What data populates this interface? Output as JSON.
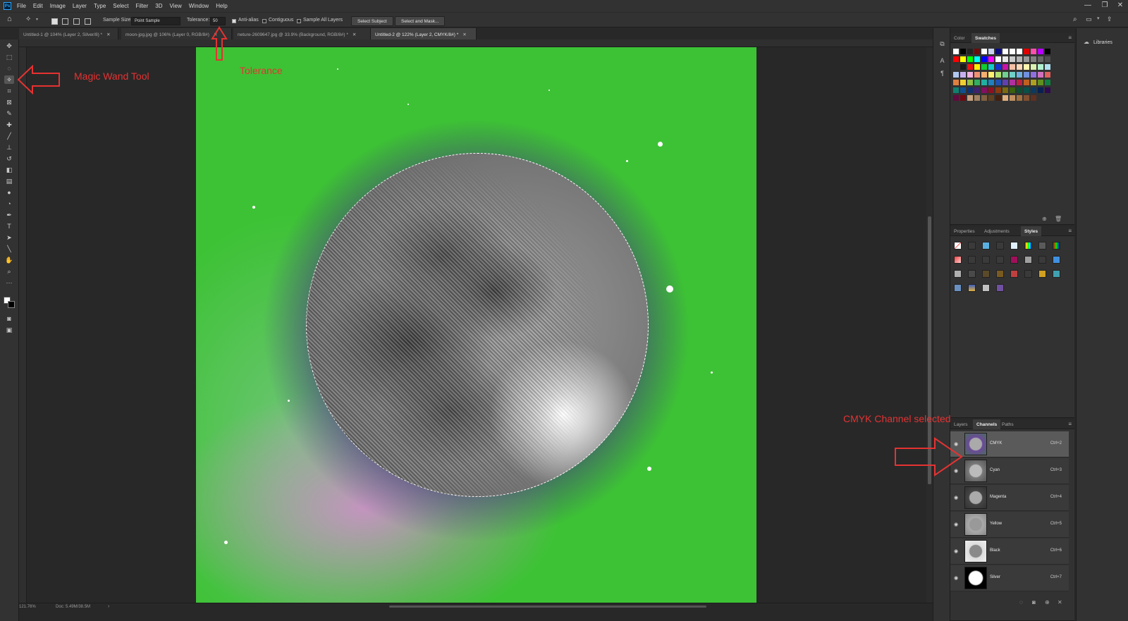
{
  "menu": {
    "items": [
      "File",
      "Edit",
      "Image",
      "Layer",
      "Type",
      "Select",
      "Filter",
      "3D",
      "View",
      "Window",
      "Help"
    ]
  },
  "options": {
    "sample_size_label": "Sample Size:",
    "sample_size_value": "Point Sample",
    "tolerance_label": "Tolerance:",
    "tolerance_value": "50",
    "anti_alias_label": "Anti-alias",
    "anti_alias_checked": true,
    "contiguous_label": "Contiguous",
    "contiguous_checked": false,
    "sample_all_layers_label": "Sample All Layers",
    "sample_all_layers_checked": false,
    "select_subject_label": "Select Subject",
    "select_and_mask_label": "Select and Mask..."
  },
  "tabs": [
    {
      "label": "Untitled-1 @ 104% (Layer 2, Silver/8) *",
      "active": false
    },
    {
      "label": "moon-jpg.jpg @ 106% (Layer 0, RGB/8#)",
      "active": false
    },
    {
      "label": "neture-2609647.jpg @ 33.9% (Background, RGB/8#) *",
      "active": false
    },
    {
      "label": "Untitled-2 @ 122% (Layer 2, CMYK/8#) *",
      "active": true
    }
  ],
  "status": {
    "zoom": "121.76%",
    "doc_info": "Doc: 5.49M/38.5M"
  },
  "color_panel": {
    "tabs": [
      "Color",
      "Swatches"
    ],
    "active_tab": "Swatches"
  },
  "styles_panel": {
    "tabs": [
      "Properties",
      "Adjustments",
      "Styles"
    ],
    "active_tab": "Styles"
  },
  "channels_panel": {
    "tabs": [
      "Layers",
      "Channels",
      "Paths"
    ],
    "active_tab": "Channels",
    "channels": [
      {
        "name": "CMYK",
        "shortcut": "Ctrl+2",
        "selected": true
      },
      {
        "name": "Cyan",
        "shortcut": "Ctrl+3",
        "selected": false
      },
      {
        "name": "Magenta",
        "shortcut": "Ctrl+4",
        "selected": false
      },
      {
        "name": "Yellow",
        "shortcut": "Ctrl+5",
        "selected": false
      },
      {
        "name": "Black",
        "shortcut": "Ctrl+6",
        "selected": false
      },
      {
        "name": "Silver",
        "shortcut": "Ctrl+7",
        "selected": false
      }
    ]
  },
  "libraries": {
    "label": "Libraries"
  },
  "annotations": {
    "magic_wand": "Magic Wand Tool",
    "tolerance": "Tolerance",
    "cmyk_channel": "CMYK Channel selected"
  },
  "colors": {
    "annotation_red": "#e53232",
    "canvas_green": "#3dc235",
    "ui_dark": "#323232"
  },
  "icons": {
    "toolbar": [
      "move-icon",
      "marquee-icon",
      "lasso-icon",
      "magic-wand-icon",
      "crop-icon",
      "frame-icon",
      "eyedropper-icon",
      "healing-brush-icon",
      "brush-icon",
      "clone-stamp-icon",
      "history-brush-icon",
      "eraser-icon",
      "gradient-icon",
      "blur-icon",
      "dodge-icon",
      "pen-icon",
      "type-icon",
      "path-selection-icon",
      "line-icon",
      "hand-icon",
      "zoom-icon",
      "more-tools-icon"
    ]
  }
}
